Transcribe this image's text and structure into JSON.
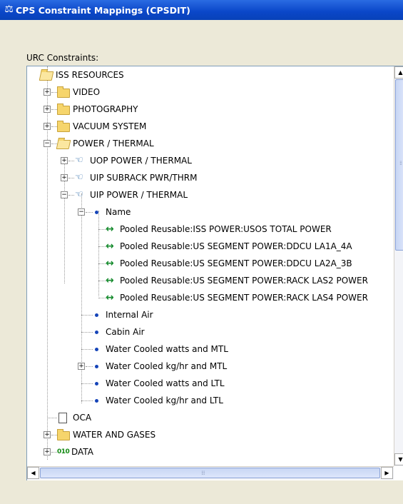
{
  "window": {
    "title": "CPS Constraint Mappings (CPSDIT)",
    "icon": "constraint-app-icon"
  },
  "panel": {
    "label": "URC Constraints:"
  },
  "tree": {
    "root": "ISS RESOURCES",
    "video": "VIDEO",
    "photography": "PHOTOGRAPHY",
    "vacuum": "VACUUM SYSTEM",
    "power_thermal": "POWER / THERMAL",
    "uop": "UOP POWER / THERMAL",
    "uip_subrack": "UIP SUBRACK PWR/THRM",
    "uip_power": "UIP POWER / THERMAL",
    "name": "Name",
    "pooled_1": "Pooled Reusable:ISS POWER:USOS TOTAL POWER",
    "pooled_2": "Pooled Reusable:US SEGMENT POWER:DDCU LA1A_4A",
    "pooled_3": "Pooled Reusable:US SEGMENT POWER:DDCU LA2A_3B",
    "pooled_4": "Pooled Reusable:US SEGMENT POWER:RACK LAS2 POWER",
    "pooled_5": "Pooled Reusable:US SEGMENT POWER:RACK LAS4 POWER",
    "internal_air": "Internal Air",
    "cabin_air": "Cabin Air",
    "wc_watts_mtl": "Water Cooled watts and MTL",
    "wc_kg_mtl": "Water Cooled kg/hr and MTL",
    "wc_watts_ltl": "Water Cooled watts and LTL",
    "wc_kg_ltl": "Water Cooled kg/hr and LTL",
    "oca": "OCA",
    "water_gases": "WATER AND GASES",
    "data": "DATA",
    "data_icon_text": "010"
  },
  "colors": {
    "title_bar": "#0a46c8",
    "window_bg": "#ece9d8",
    "link_arrow": "#148a2c",
    "node_dot": "#1544b8"
  }
}
